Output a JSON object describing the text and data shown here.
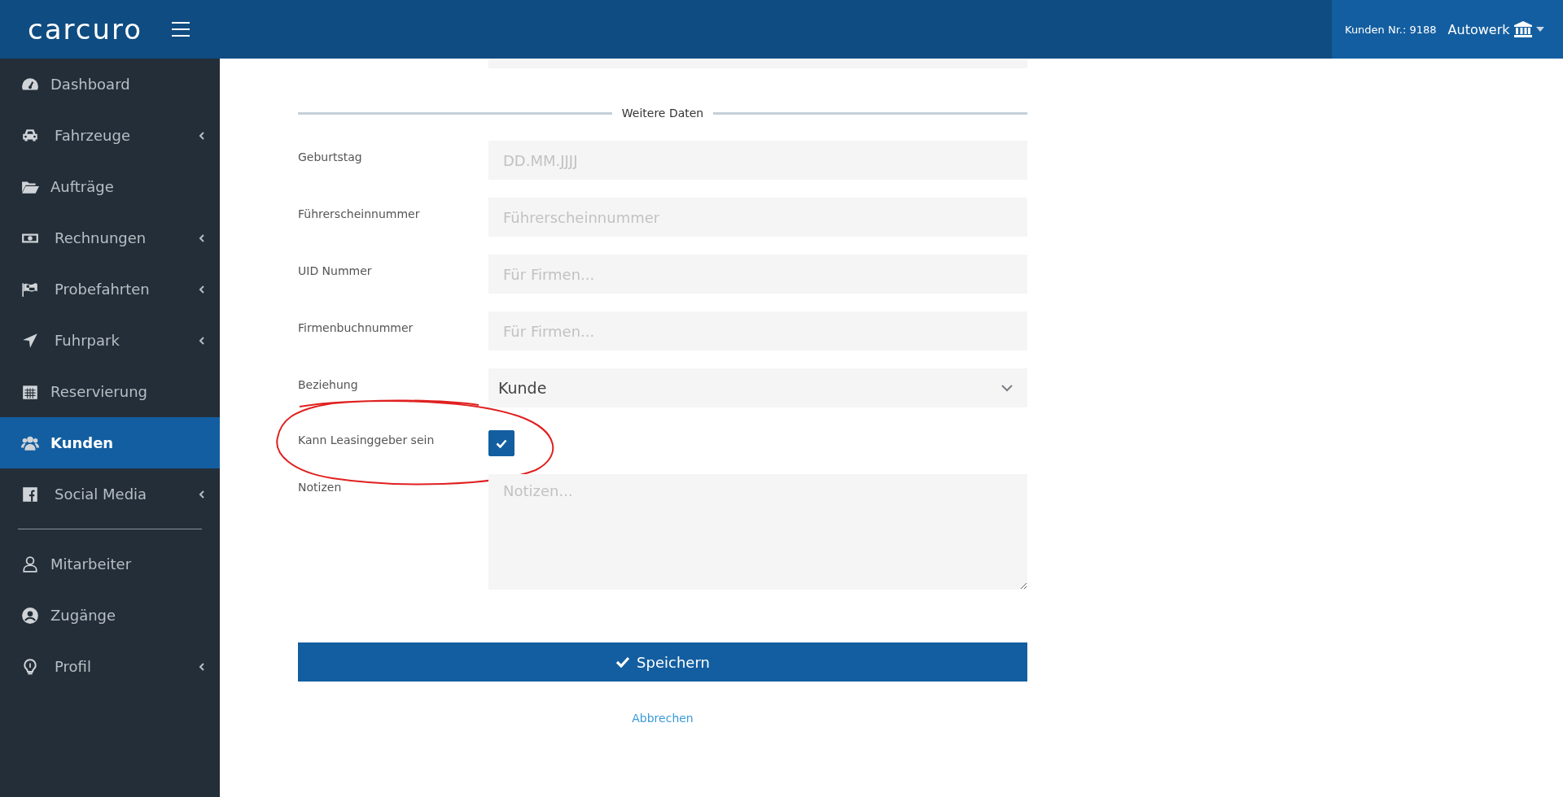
{
  "header": {
    "logo": "carcuro",
    "customer_number": "Kunden Nr.: 9188",
    "account": "Autowerk"
  },
  "sidebar": {
    "groups": [
      [
        {
          "label": "Dashboard",
          "selected": false,
          "expandable": false
        },
        {
          "label": "Fahrzeuge",
          "selected": false,
          "expandable": true
        },
        {
          "label": "Aufträge",
          "selected": false,
          "expandable": false
        },
        {
          "label": "Rechnungen",
          "selected": false,
          "expandable": true
        },
        {
          "label": "Probefahrten",
          "selected": false,
          "expandable": true
        },
        {
          "label": "Fuhrpark",
          "selected": false,
          "expandable": true
        },
        {
          "label": "Reservierung",
          "selected": false,
          "expandable": false
        },
        {
          "label": "Kunden",
          "selected": true,
          "expandable": false
        },
        {
          "label": "Social Media",
          "selected": false,
          "expandable": true
        }
      ],
      [
        {
          "label": "Mitarbeiter",
          "selected": false,
          "expandable": false
        },
        {
          "label": "Zugänge",
          "selected": false,
          "expandable": false
        },
        {
          "label": "Profil",
          "selected": false,
          "expandable": true
        }
      ]
    ]
  },
  "form": {
    "previous_field": {
      "kind": "input"
    },
    "section_title": "Weitere Daten",
    "rows": [
      {
        "kind": "input",
        "label": "Geburtstag",
        "placeholder": "DD.MM.JJJJ"
      },
      {
        "kind": "input",
        "label": "Führerscheinnummer",
        "placeholder": "Führerscheinnummer"
      },
      {
        "kind": "input",
        "label": "UID Nummer",
        "placeholder": "Für Firmen..."
      },
      {
        "kind": "input",
        "label": "Firmenbuchnummer",
        "placeholder": "Für Firmen..."
      },
      {
        "kind": "select",
        "label": "Beziehung",
        "value": "Kunde"
      },
      {
        "kind": "checkbox",
        "label": "Kann Leasinggeber sein",
        "checked": true,
        "annotation": {
          "kind": "ellipse"
        }
      },
      {
        "kind": "textarea",
        "label": "Notizen",
        "placeholder": "Notizen..."
      }
    ],
    "save_button": "Speichern",
    "cancel_link": "Abbrechen"
  }
}
